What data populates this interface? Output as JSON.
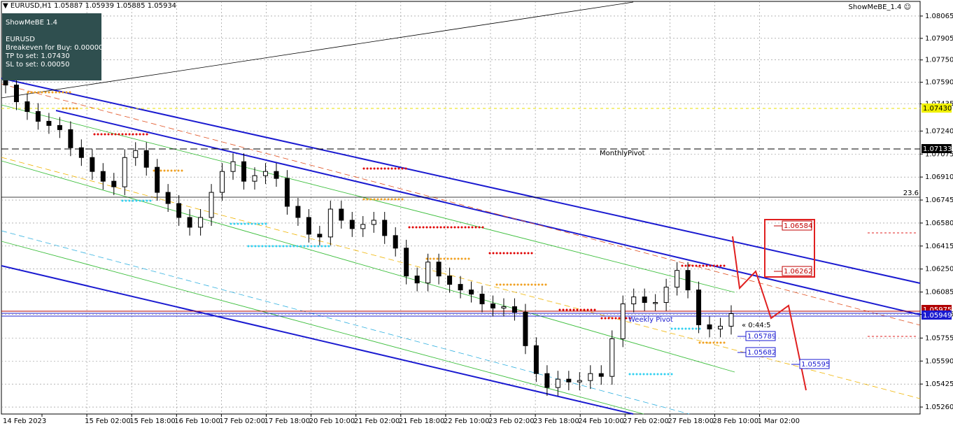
{
  "header": {
    "symbol": "EURUSD,H1",
    "quote": "1.05887 1.05939 1.05885 1.05934",
    "indicator": "ShowMeBE_1.4"
  },
  "panel": {
    "title": "ShowMeBE 1.4",
    "symbol": "EURUSD",
    "breakeven": "Breakeven for Buy: 0.00000",
    "tp": "TP to set: 1.07430",
    "sl": "SL to set: 0.00050"
  },
  "colors": {
    "channel": "#1a1ad0",
    "green_channel": "#3cbe3c",
    "red_levels": "#e00000",
    "orange_levels": "#f0a020",
    "cyan_levels": "#30d0f0",
    "candles": "#000000"
  },
  "labels": {
    "monthly_pivot": "MonthlyPivot",
    "weekly_pivot": "Weekly Pivot",
    "fib": "23.6",
    "countdown": "« 0:44:5"
  },
  "price_boxes": {
    "monthly": "1.07133",
    "current": "1.05949",
    "yellow": "1.07430",
    "red_top": "1.05975"
  },
  "level_tags": [
    "1.06584",
    "1.06262",
    "1.05789",
    "1.05682",
    "1.05595"
  ],
  "chart_data": {
    "type": "line",
    "title": "EURUSD,H1",
    "price_axis": [
      "1.08065",
      "1.07905",
      "1.07750",
      "1.07590",
      "1.07435",
      "1.07240",
      "1.07075",
      "1.06910",
      "1.06745",
      "1.06580",
      "1.06415",
      "1.06250",
      "1.06085",
      "1.05925",
      "1.05755",
      "1.05590",
      "1.05425",
      "1.05260"
    ],
    "time_axis": [
      "14 Feb 2023",
      "15 Feb 02:00",
      "15 Feb 18:00",
      "16 Feb 10:00",
      "17 Feb 02:00",
      "17 Feb 18:00",
      "20 Feb 10:00",
      "21 Feb 02:00",
      "21 Feb 18:00",
      "22 Feb 10:00",
      "23 Feb 02:00",
      "23 Feb 18:00",
      "24 Feb 10:00",
      "27 Feb 02:00",
      "27 Feb 18:00",
      "28 Feb 10:00",
      "1 Mar 02:00"
    ],
    "ylim": [
      1.0521,
      1.0817
    ],
    "series": [
      {
        "name": "EURUSD",
        "values": [
          1.0757,
          1.0745,
          1.0738,
          1.0731,
          1.0728,
          1.0725,
          1.0712,
          1.0705,
          1.0695,
          1.0688,
          1.0684,
          1.0705,
          1.071,
          1.0698,
          1.068,
          1.0672,
          1.0662,
          1.0655,
          1.0662,
          1.068,
          1.0695,
          1.0702,
          1.0688,
          1.0692,
          1.0695,
          1.069,
          1.067,
          1.0662,
          1.065,
          1.0648,
          1.0668,
          1.066,
          1.0654,
          1.0657,
          1.066,
          1.0649,
          1.064,
          1.062,
          1.0615,
          1.063,
          1.062,
          1.0614,
          1.061,
          1.0607,
          1.06,
          1.0597,
          1.0598,
          1.0594,
          1.057,
          1.055,
          1.054,
          1.0546,
          1.0544,
          1.0545,
          1.055,
          1.0548,
          1.0575,
          1.06,
          1.0605,
          1.0601,
          1.0601,
          1.0612,
          1.0624,
          1.061,
          1.0585,
          1.0582,
          1.0584,
          1.0593
        ]
      }
    ]
  }
}
